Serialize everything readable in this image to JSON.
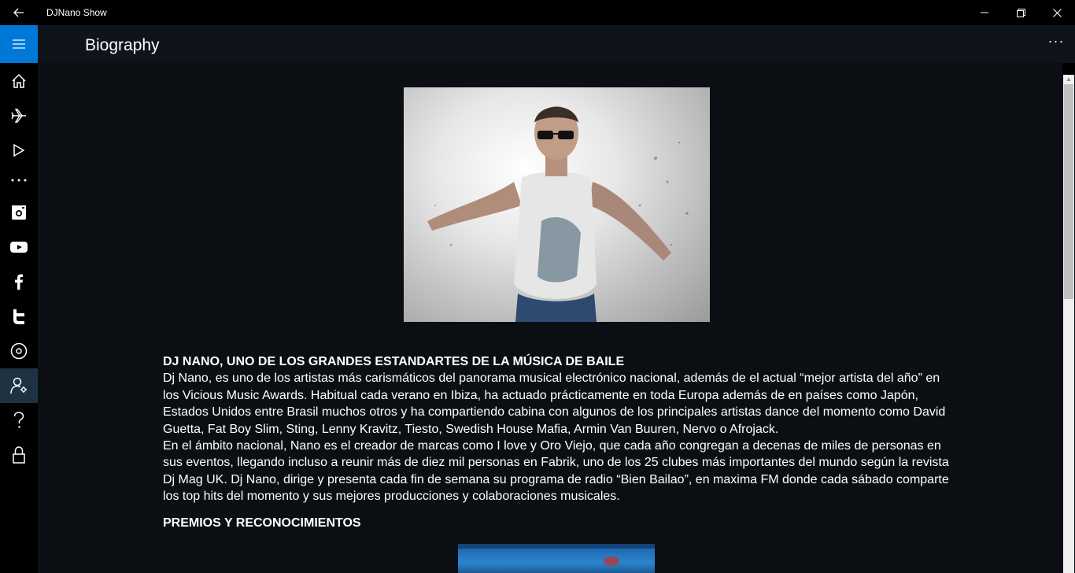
{
  "window": {
    "title": "DJNano Show",
    "controls": {
      "minimize": "—",
      "restore": "❐",
      "close": "✕"
    }
  },
  "nav": {
    "items": [
      {
        "icon": "hamburger-icon"
      },
      {
        "icon": "home-icon"
      },
      {
        "icon": "plane-icon"
      },
      {
        "icon": "play-icon"
      },
      {
        "icon": "more-horizontal-icon"
      },
      {
        "icon": "instagram-icon"
      },
      {
        "icon": "youtube-icon"
      },
      {
        "icon": "facebook-icon"
      },
      {
        "icon": "twitter-icon"
      },
      {
        "icon": "disc-icon"
      },
      {
        "icon": "user-profile-icon",
        "active": true
      },
      {
        "icon": "help-icon"
      },
      {
        "icon": "lock-icon"
      }
    ],
    "accent": "#0078d7",
    "active_bg": "#1f3244"
  },
  "header": {
    "title": "Biography",
    "more": "···"
  },
  "article": {
    "heading": "DJ NANO, UNO DE LOS GRANDES ESTANDARTES DE LA MÚSICA DE BAILE",
    "paragraph1": "Dj Nano, es uno de los artistas más carismáticos del panorama musical electrónico nacional, además de el actual “mejor artista del año” en los Vicious Music Awards. Habitual cada verano en Ibiza, ha actuado prácticamente en toda Europa además de en países como Japón, Estados Unidos entre Brasil muchos otros y ha compartiendo cabina con algunos de los principales artistas dance del momento como David Guetta, Fat Boy Slim, Sting, Lenny Kravitz, Tiesto, Swedish House Mafia, Armin Van Buuren, Nervo o Afrojack.",
    "paragraph2": "En el ámbito nacional, Nano es el creador de marcas como I love y Oro Viejo, que cada año congregan a decenas de miles de personas en sus eventos, llegando incluso a reunir más de diez mil personas en Fabrik, uno de los 25 clubes más importantes del mundo según la revista Dj Mag UK. Dj Nano, dirige y presenta cada fin de semana su programa de radio “Bien Bailao”, en maxima FM donde cada sábado comparte los top hits del momento y sus mejores producciones y colaboraciones musicales.",
    "section2": "PREMIOS Y RECONOCIMIENTOS"
  },
  "colors": {
    "content_bg": "#0b0f14",
    "header_bg": "#0f141a"
  }
}
